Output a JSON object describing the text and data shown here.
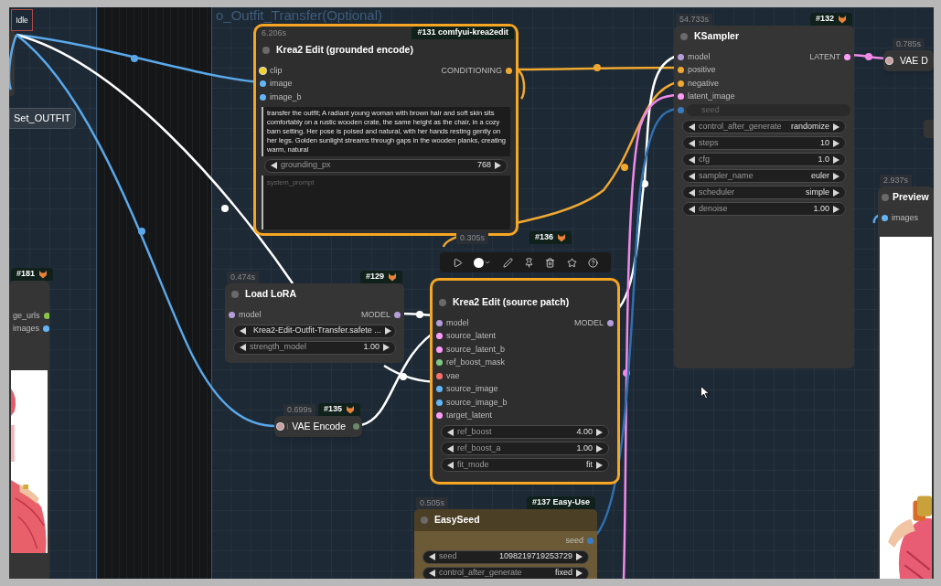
{
  "status": "Idle",
  "group_title": "o_Outfit_Transfer(Optional)",
  "nodes": [
    {
      "kind": "label",
      "title": "Set_OUTFIT",
      "selected": false
    },
    {
      "kind": "node",
      "selected": true,
      "time": "6.206s",
      "badge": {
        "text": "#131 comfyui-krea2edit",
        "kind": "plain"
      },
      "title": "Krea2 Edit (grounded encode)",
      "inputs": [
        {
          "label": "clip",
          "color": "#f2d024"
        },
        {
          "label": "image",
          "color": "#64b5f6"
        },
        {
          "label": "image_b",
          "color": "#64b5f6"
        }
      ],
      "outputs": [
        {
          "label": "CONDITIONING",
          "color": "#f0a830"
        }
      ],
      "widgets": [
        {
          "kind": "text",
          "value": "transfer the outfit; A radiant young woman with brown hair and soft skin sits comfortably on a rustic wooden crate, the same height as the chair, in a cozy barn setting. Her pose is poised and natural, with her hands resting gently on her legs. Golden sunlight streams through gaps in the wooden planks, creating warm, natural"
        },
        {
          "kind": "value",
          "label": "grounding_px",
          "value": "768"
        },
        {
          "kind": "text",
          "placeholder": "system_prompt"
        }
      ]
    },
    {
      "kind": "node",
      "selected": false,
      "time": "54.733s",
      "badge": {
        "text": "#132",
        "kind": "fox"
      },
      "title": "KSampler",
      "inputs": [
        {
          "label": "model",
          "color": "#b39ddb"
        },
        {
          "label": "positive",
          "color": "#f0a830"
        },
        {
          "label": "negative",
          "color": "#f0a830"
        },
        {
          "label": "latent_image",
          "color": "#ff9cf9"
        }
      ],
      "outputs": [
        {
          "label": "LATENT",
          "color": "#ff9cf9"
        }
      ],
      "converted_inputs": [
        {
          "label": "seed",
          "color": "#3a7cc4"
        }
      ],
      "widgets": [
        {
          "kind": "value",
          "label": "control_after_generate",
          "value": "randomize"
        },
        {
          "kind": "value",
          "label": "steps",
          "value": "10"
        },
        {
          "kind": "value",
          "label": "cfg",
          "value": "1.0"
        },
        {
          "kind": "value",
          "label": "sampler_name",
          "value": "euler"
        },
        {
          "kind": "value",
          "label": "scheduler",
          "value": "simple"
        },
        {
          "kind": "value",
          "label": "denoise",
          "value": "1.00"
        }
      ]
    },
    {
      "kind": "collapsed",
      "selected": false,
      "time": "0.785s",
      "title": "VAE D",
      "inputs": [
        {
          "color": "#c9a0a0"
        }
      ]
    },
    {
      "kind": "node",
      "selected": false,
      "time": "2.937s",
      "title": "Preview",
      "inputs": [
        {
          "label": "images",
          "color": "#64b5f6"
        }
      ],
      "preview": {
        "kind": "picture"
      }
    },
    {
      "kind": "node",
      "selected": false,
      "time": "0.305s",
      "badge": {
        "text": "#136",
        "kind": "fox"
      }
    },
    {
      "kind": "node",
      "selected": false,
      "badge": {
        "text": "#181",
        "kind": "fox"
      },
      "outputs": [
        {
          "label": "ge_urls",
          "color": "#8bc34a"
        },
        {
          "label": "images",
          "color": "#64b5f6"
        }
      ],
      "preview": {
        "kind": "picture"
      }
    },
    {
      "kind": "node",
      "selected": false,
      "time": "0.474s",
      "badge": {
        "text": "#129",
        "kind": "fox"
      },
      "title": "Load LoRA",
      "inputs": [
        {
          "label": "model",
          "color": "#b39ddb"
        }
      ],
      "outputs": [
        {
          "label": "MODEL",
          "color": "#b39ddb"
        }
      ],
      "widgets": [
        {
          "kind": "value",
          "value": "Krea2-Edit-Outfit-Transfer.safete ..."
        },
        {
          "kind": "value",
          "label": "strength_model",
          "value": "1.00"
        }
      ]
    },
    {
      "kind": "node",
      "selected": true,
      "title": "Krea2 Edit (source patch)",
      "inputs": [
        {
          "label": "model",
          "color": "#b39ddb"
        },
        {
          "label": "source_latent",
          "color": "#ff9cf9"
        },
        {
          "label": "source_latent_b",
          "color": "#ff9cf9"
        },
        {
          "label": "ref_boost_mask",
          "color": "#81c784"
        },
        {
          "label": "vae",
          "color": "#ff6e6e"
        },
        {
          "label": "source_image",
          "color": "#64b5f6"
        },
        {
          "label": "source_image_b",
          "color": "#64b5f6"
        },
        {
          "label": "target_latent",
          "color": "#ff9cf9"
        }
      ],
      "outputs": [
        {
          "label": "MODEL",
          "color": "#b39ddb"
        }
      ],
      "widgets": [
        {
          "kind": "value",
          "label": "ref_boost",
          "value": "4.00"
        },
        {
          "kind": "value",
          "label": "ref_boost_a",
          "value": "1.00"
        },
        {
          "kind": "value",
          "label": "fit_mode",
          "value": "fit"
        }
      ]
    },
    {
      "kind": "collapsed",
      "selected": false,
      "time": "0.699s",
      "badge": {
        "text": "#135",
        "kind": "fox"
      },
      "title": "VAE Encode",
      "inputs": [
        {
          "color": "#c9a0a0"
        }
      ],
      "outputs": [
        {
          "color": "#6b8a6b"
        }
      ]
    },
    {
      "kind": "node",
      "selected": false,
      "color": "#6b5a35",
      "time": "0.505s",
      "badge": {
        "text": "#137 Easy-Use",
        "kind": "plain"
      },
      "title": "EasySeed",
      "outputs": [
        {
          "label": "seed",
          "color": "#3a7cc4"
        }
      ],
      "widgets": [
        {
          "kind": "value",
          "label": "seed",
          "value": "1098219719253729"
        },
        {
          "kind": "value",
          "label": "control_after_generate",
          "value": "fixed"
        }
      ]
    }
  ]
}
